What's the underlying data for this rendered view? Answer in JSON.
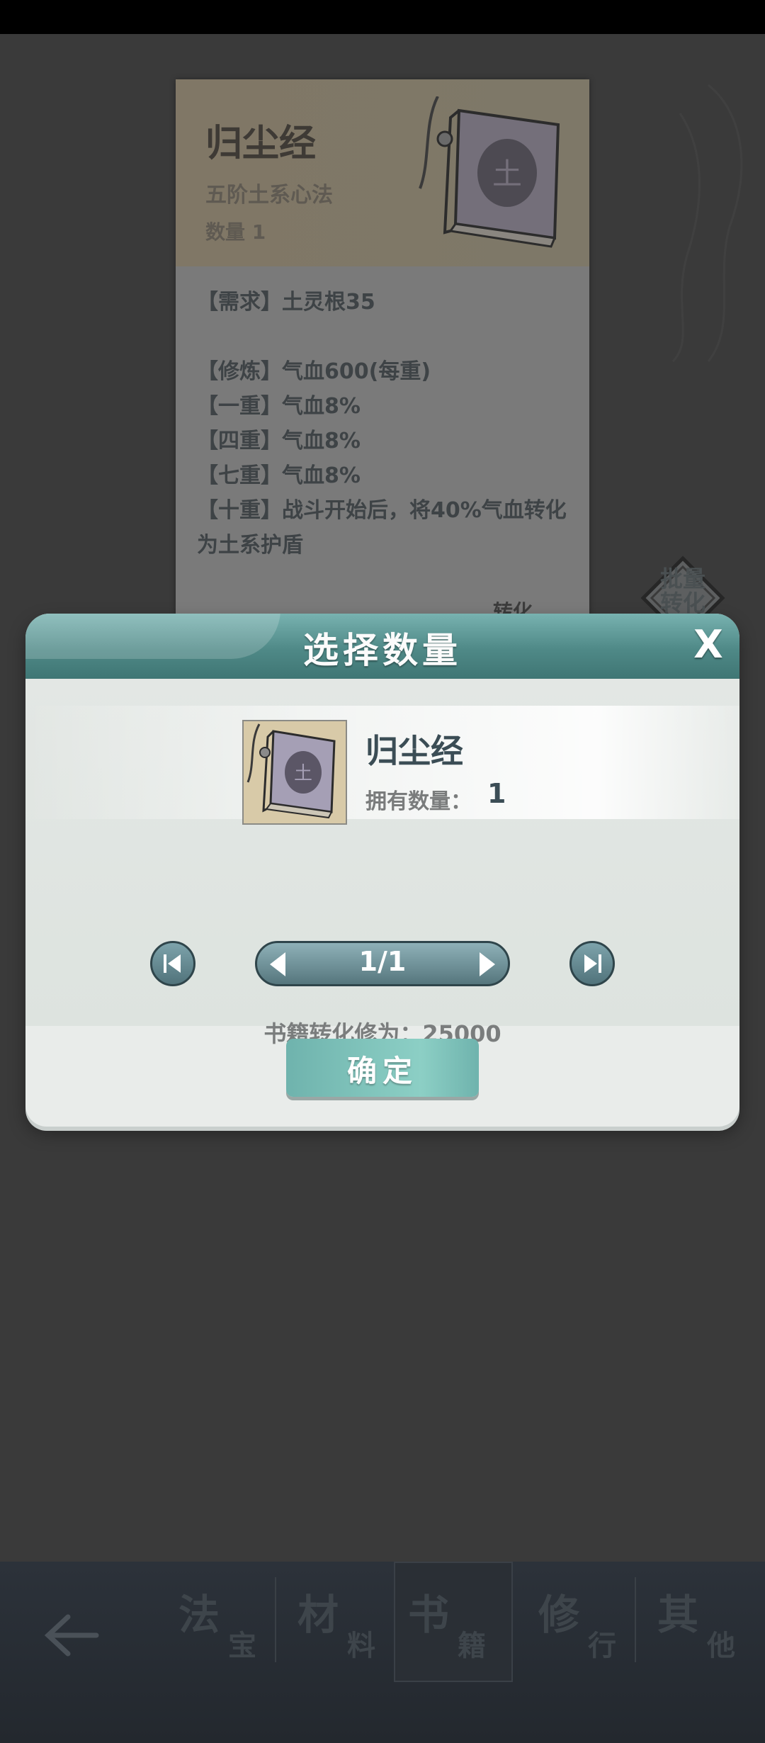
{
  "background_card": {
    "title": "归尘经",
    "subtitle": "五阶土系心法",
    "quantity": "数量 1",
    "lines": [
      "【需求】土灵根35",
      "",
      "【修炼】气血600(每重)",
      "【一重】气血8%",
      "【四重】气血8%",
      "【七重】气血8%",
      "【十重】战斗开始后，将40%气血转化为土系护盾"
    ],
    "convert_label": "转化",
    "batch_label": "批量转化"
  },
  "modal": {
    "title": "选择数量",
    "close_label": "X",
    "item_name": "归尘经",
    "owned_label": "拥有数量：",
    "owned_value": "1",
    "stepper_value": "1/1",
    "convert_text": "书籍转化修为：25000",
    "confirm_label": "确定"
  },
  "bottom_nav": {
    "tabs": [
      {
        "big": "法",
        "small": "宝"
      },
      {
        "big": "材",
        "small": "料"
      },
      {
        "big": "书",
        "small": "籍"
      },
      {
        "big": "修",
        "small": "行"
      },
      {
        "big": "其",
        "small": "他"
      }
    ],
    "active_index": 2
  },
  "colors": {
    "modal_header": "#4f8987",
    "confirm_button": "#7cc2ba",
    "round_button": "#5d818a"
  }
}
